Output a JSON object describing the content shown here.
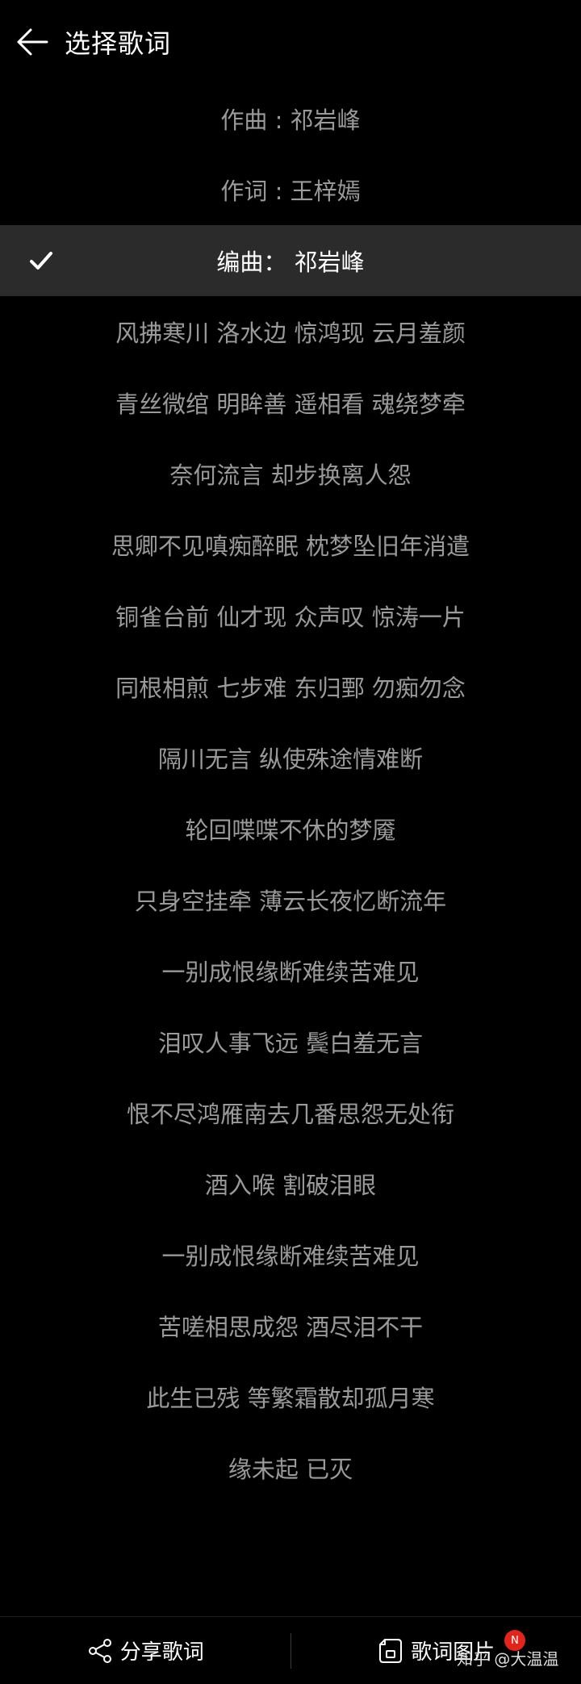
{
  "header": {
    "title": "选择歌词"
  },
  "lyrics": [
    "作曲 : 祁岩峰",
    "作词 : 王梓嫣",
    "编曲： 祁岩峰",
    "风拂寒川 洛水边 惊鸿现 云月羞颜",
    "青丝微绾 明眸善 遥相看 魂绕梦牵",
    "奈何流言 却步换离人怨",
    "思卿不见嗔痴醉眠 枕梦坠旧年消遣",
    "铜雀台前 仙才现 众声叹 惊涛一片",
    "同根相煎 七步难 东归鄄 勿痴勿念",
    "隔川无言 纵使殊途情难断",
    "轮回喋喋不休的梦魇",
    "只身空挂牵 薄云长夜忆断流年",
    "一别成恨缘断难续苦难见",
    "泪叹人事飞远 鬓白羞无言",
    "恨不尽鸿雁南去几番思怨无处衔",
    "酒入喉 割破泪眼",
    "一别成恨缘断难续苦难见",
    "苦嗟相思成怨 酒尽泪不干",
    "此生已残 等繁霜散却孤月寒",
    "缘未起 已灭"
  ],
  "selected_index": 2,
  "footer": {
    "share_label": "分享歌词",
    "image_label": "歌词图片"
  },
  "badge": "N",
  "watermark": "知乎 @大温温"
}
